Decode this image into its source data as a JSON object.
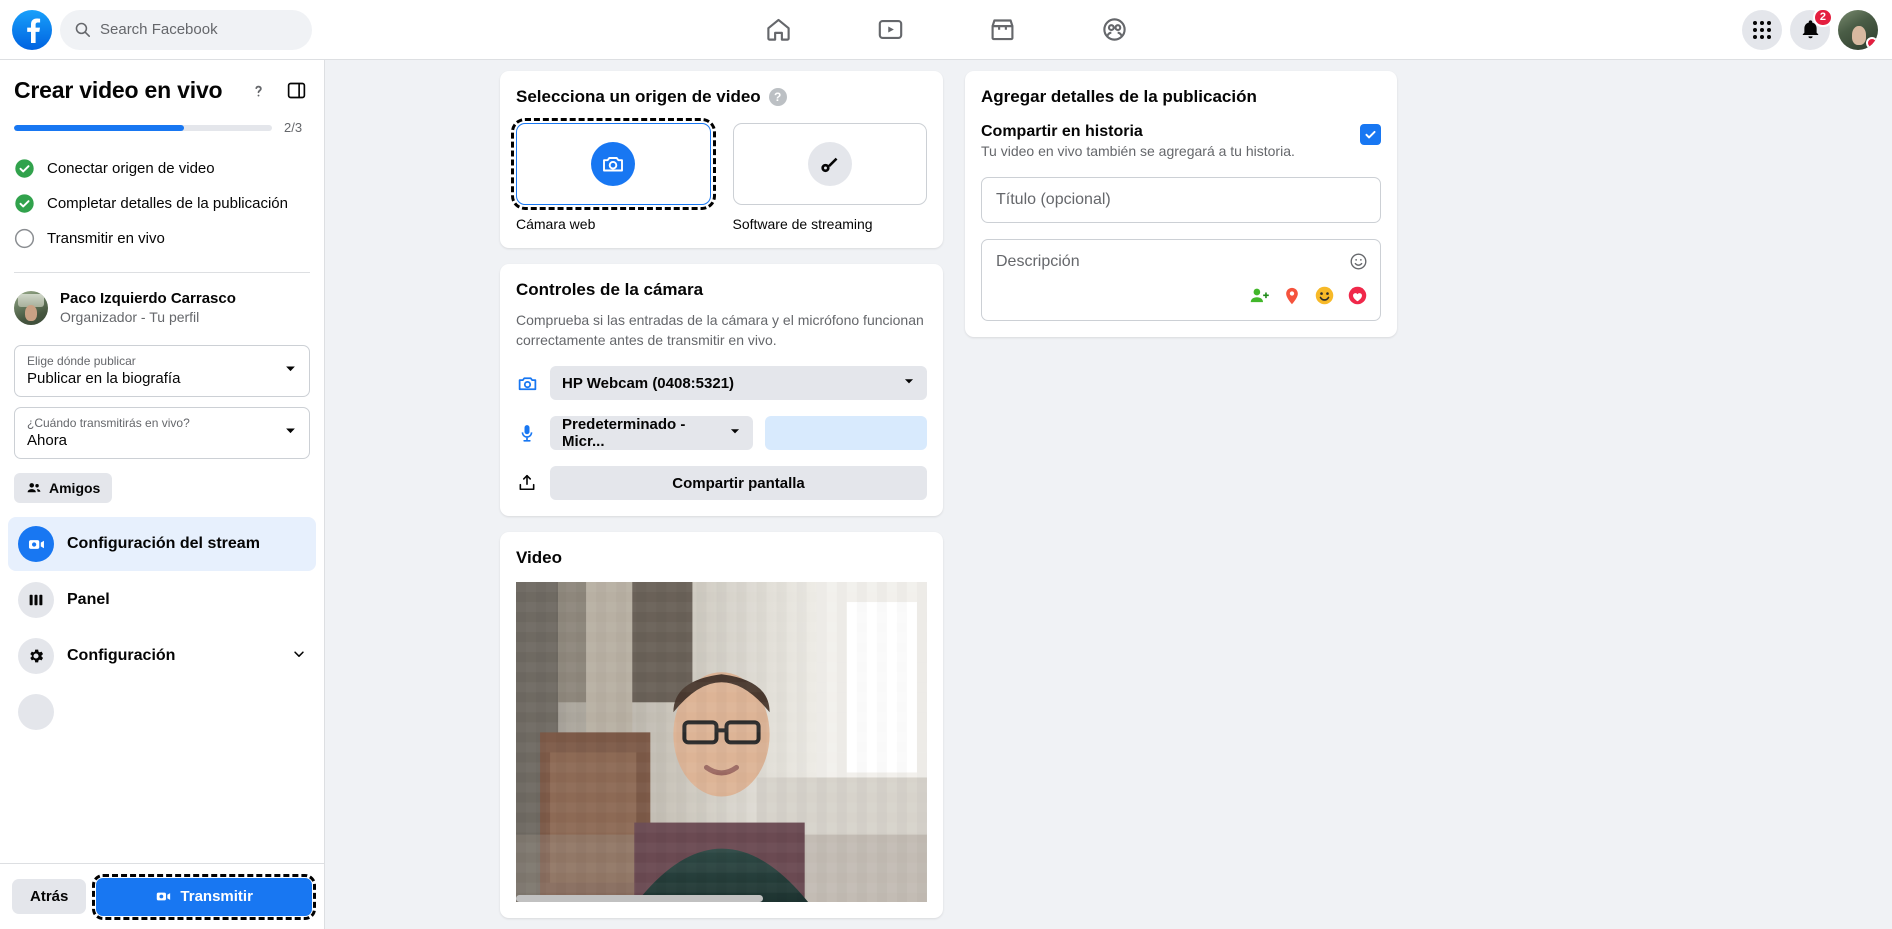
{
  "topnav": {
    "search_placeholder": "Search Facebook",
    "logo_name": "facebook-logo",
    "tabs": [
      {
        "name": "home",
        "icon": "home-icon"
      },
      {
        "name": "video",
        "icon": "video-icon"
      },
      {
        "name": "marketplace",
        "icon": "marketplace-icon"
      },
      {
        "name": "groups",
        "icon": "groups-icon"
      }
    ],
    "notifications_count": "2",
    "menu_icon": "grid-menu-icon",
    "bell_icon": "bell-icon",
    "avatar_name": "profile-avatar"
  },
  "sidebar": {
    "title": "Crear video en vivo",
    "help_icon": "question-mark-icon",
    "panel_toggle_icon": "panel-toggle-icon",
    "progress": {
      "label": "2/3",
      "percent": 66
    },
    "steps": [
      {
        "label": "Conectar origen de video",
        "state": "done"
      },
      {
        "label": "Completar detalles de la publicación",
        "state": "done"
      },
      {
        "label": "Transmitir en vivo",
        "state": "pending"
      }
    ],
    "user": {
      "name": "Paco Izquierdo Carrasco",
      "role": "Organizador - Tu perfil"
    },
    "selects": [
      {
        "label": "Elige dónde publicar",
        "value": "Publicar en la biografía"
      },
      {
        "label": "¿Cuándo transmitirás en vivo?",
        "value": "Ahora"
      }
    ],
    "audience_pill": {
      "label": "Amigos",
      "icon": "friends-icon"
    },
    "menu": [
      {
        "label": "Configuración del stream",
        "icon": "stream-camera-icon",
        "active": true,
        "chevron": false
      },
      {
        "label": "Panel",
        "icon": "dashboard-icon",
        "active": false,
        "chevron": false
      },
      {
        "label": "Configuración",
        "icon": "gear-icon",
        "active": false,
        "chevron": true
      }
    ],
    "footer": {
      "back_label": "Atrás",
      "go_live_label": "Transmitir",
      "go_live_icon": "stream-camera-icon"
    }
  },
  "video_source": {
    "title": "Selecciona un origen de video",
    "help_icon": "question-mark-icon",
    "options": [
      {
        "label": "Cámara web",
        "icon": "camera-icon",
        "selected": true
      },
      {
        "label": "Software de streaming",
        "icon": "key-icon",
        "selected": false
      }
    ]
  },
  "camera_controls": {
    "title": "Controles de la cámara",
    "subtitle": "Comprueba si las entradas de la cámara y el micrófono funcionan correctamente antes de transmitir en vivo.",
    "camera": {
      "icon": "camera-icon",
      "value": "HP Webcam (0408:5321)"
    },
    "microphone": {
      "icon": "microphone-icon",
      "value": "Predeterminado - Micr..."
    },
    "share_screen": {
      "icon": "share-screen-icon",
      "label": "Compartir pantalla"
    }
  },
  "video_preview": {
    "title": "Video"
  },
  "post_details": {
    "title": "Agregar detalles de la publicación",
    "share_story": {
      "title": "Compartir en historia",
      "subtitle": "Tu video en vivo también se agregará a tu historia.",
      "checked": true
    },
    "title_field": {
      "placeholder": "Título (opcional)",
      "value": ""
    },
    "description_field": {
      "placeholder": "Descripción",
      "value": ""
    },
    "description_icons": [
      "emoji-smiley-icon",
      "tag-person-icon",
      "location-pin-icon",
      "emoji-icon",
      "feeling-icon"
    ]
  },
  "colors": {
    "brand_blue": "#1877f2",
    "success_green": "#31a24c",
    "page_bg": "#f0f2f5",
    "card_bg": "#ffffff",
    "text_primary": "#050505",
    "text_secondary": "#65676b",
    "notification_red": "#e41e3f"
  }
}
